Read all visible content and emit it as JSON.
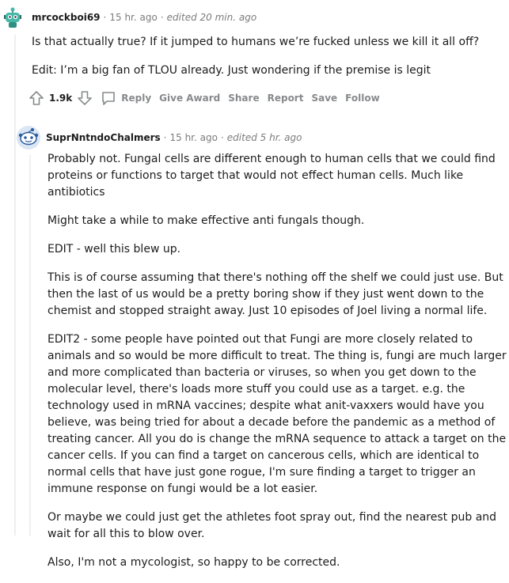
{
  "comments": [
    {
      "author": "mrcockboi69",
      "time": "15 hr. ago",
      "edited": "edited 20 min. ago",
      "paragraphs": [
        "Is that actually true? If it jumped to humans we’re fucked unless we kill it all off?",
        "Edit: I’m a big fan of TLOU already. Just wondering if the premise is legit"
      ],
      "score": "1.9k",
      "actions": {
        "reply": "Reply",
        "award": "Give Award",
        "share": "Share",
        "report": "Report",
        "save": "Save",
        "follow": "Follow"
      }
    },
    {
      "author": "SuprNntndoChalmers",
      "time": "15 hr. ago",
      "edited": "edited 5 hr. ago",
      "paragraphs": [
        "Probably not. Fungal cells are different enough to human cells that we could find proteins or functions to target that would not effect human cells. Much like antibiotics",
        "Might take a while to make effective anti fungals though.",
        "EDIT - well this blew up.",
        "This is of course assuming that there's nothing off the shelf we could just use. But then the last of us would be a pretty boring show if they just went down to the chemist and stopped straight away. Just 10 episodes of Joel living a normal life.",
        "EDIT2 - some people have pointed out that Fungi are more closely related to animals and so would be more difficult to treat. The thing is, fungi are much larger and more complicated than bacteria or viruses, so when you get down to the molecular level, there's loads more stuff you could use as a target. e.g. the technology used in mRNA vaccines; despite what anit-vaxxers would have you believe, was being tried for about a decade before the pandemic as a method of treating cancer. All you do is change the mRNA sequence to attack a target on the cancer cells. If you can find a target on cancerous cells, which are identical to normal cells that have just gone rogue, I'm sure finding a target to trigger an immune response on fungi would be a lot easier.",
        "Or maybe we could just get the athletes foot spray out, find the nearest pub and wait for all this to blow over.",
        "Also, I'm not a mycologist, so happy to be corrected."
      ]
    }
  ],
  "separator": "·",
  "colors": {
    "meta": "#7c7c7c",
    "action": "#878a8c",
    "thread": "#edeff1",
    "avatar_teal": "#46b8a8",
    "avatar_blue": "#2b5c9e"
  },
  "icons": [
    "avatar-robot-icon",
    "upvote-arrow-icon",
    "downvote-arrow-icon",
    "comment-bubble-icon",
    "avatar-snoo-icon"
  ]
}
